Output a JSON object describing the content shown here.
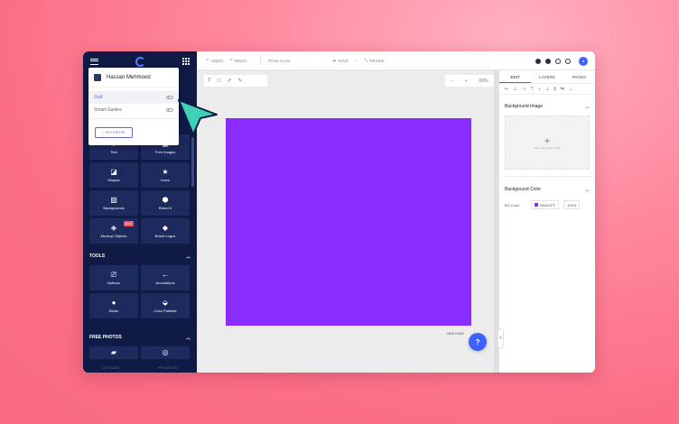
{
  "sidebar": {
    "popup": {
      "user_name": "Hassan Mehmood",
      "grid_label": "Grid",
      "smart_guides_label": "Smart Guides",
      "exit_label": "EXIT EDITOR"
    },
    "tiles": [
      {
        "label": "Text",
        "icon": "text-icon"
      },
      {
        "label": "Free Images",
        "icon": "image-icon"
      },
      {
        "label": "Shapes",
        "icon": "shapes-icon"
      },
      {
        "label": "Icons",
        "icon": "star-icon"
      },
      {
        "label": "Backgrounds",
        "icon": "background-icon"
      },
      {
        "label": "Brand It",
        "icon": "tag-icon"
      },
      {
        "label": "Mockup Objects",
        "icon": "cube-icon",
        "badge": "NEW"
      },
      {
        "label": "Brand Logos",
        "icon": "diamond-icon"
      }
    ],
    "tools_heading": "TOOLS",
    "tools": [
      {
        "label": "Buttons",
        "icon": "button-icon"
      },
      {
        "label": "Annotations",
        "icon": "arrow-left-icon"
      },
      {
        "label": "Blobs",
        "icon": "blob-icon"
      },
      {
        "label": "Color Palettes",
        "icon": "palette-icon"
      }
    ],
    "free_photos_heading": "FREE PHOTOS",
    "footer": {
      "uploads": "UPLOADS",
      "projects": "PROJECTS"
    }
  },
  "toolbar": {
    "undo": "UNDO",
    "redo": "REDO",
    "file_name": "Prime Cover",
    "save": "SAVE",
    "resize": "RESIZE"
  },
  "canvas": {
    "zoom": "69%",
    "artboard_color": "#8A2CFF",
    "new_page": "NEW PAGE",
    "help": "?"
  },
  "panel": {
    "tabs": [
      "EDIT",
      "LAYERS",
      "PAGES"
    ],
    "bg_image_heading": "Background Image",
    "upload_hint": "Add Image (Max 5 Mb)",
    "bg_color_heading": "Background Color",
    "color_label": "BG Color",
    "color_hex": "#8A2CFF",
    "opacity": "100%"
  },
  "colors": {
    "accent": "#3F61FF",
    "sidebar_bg": "#0F1A45",
    "cursor": "#3FD1B5"
  }
}
